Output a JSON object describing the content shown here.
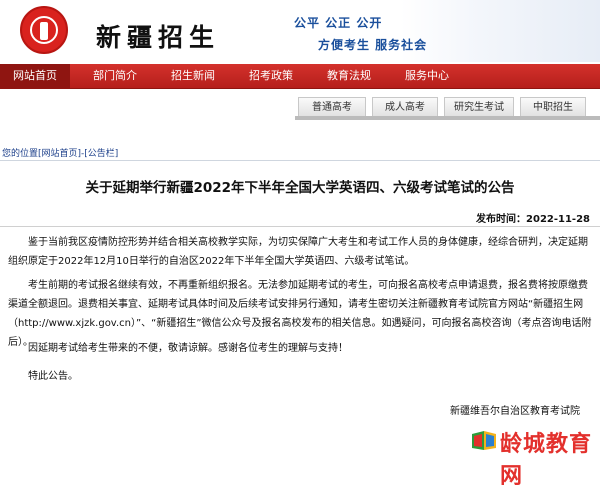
{
  "header": {
    "site_name": "新疆招生",
    "slogan_line1": "公平 公正 公开",
    "slogan_line2": "方便考生  服务社会"
  },
  "nav": {
    "items": [
      {
        "label": "网站首页",
        "active": true
      },
      {
        "label": "部门简介"
      },
      {
        "label": "招生新闻"
      },
      {
        "label": "招考政策"
      },
      {
        "label": "教育法规"
      },
      {
        "label": "服务中心"
      }
    ]
  },
  "subtabs": [
    "普通高考",
    "成人高考",
    "研究生考试",
    "中职招生"
  ],
  "breadcrumb": "您的位置[网站首页]-[公告栏]",
  "article": {
    "title": "关于延期举行新疆2022年下半年全国大学英语四、六级考试笔试的公告",
    "date_label": "发布时间：",
    "date": "2022-11-28",
    "paragraphs": [
      "鉴于当前我区疫情防控形势并结合相关高校教学实际，为切实保障广大考生和考试工作人员的身体健康，经综合研判，决定延期组织原定于2022年12月10日举行的自治区2022年下半年全国大学英语四、六级考试笔试。",
      "考生前期的考试报名继续有效，不再重新组织报名。无法参加延期考试的考生，可向报名高校考点申请退费，报名费将按原缴费渠道全额退回。退费相关事宜、延期考试具体时间及后续考试安排另行通知，请考生密切关注新疆教育考试院官方网站“新疆招生网（http://www.xjzk.gov.cn）”、“新疆招生”微信公众号及报名高校发布的相关信息。如遇疑问，可向报名高校咨询（考点咨询电话附后）。",
      "因延期考试给考生带来的不便，敬请谅解。感谢各位考生的理解与支持！",
      "特此公告。"
    ],
    "signer": "新疆维吾尔自治区教育考试院"
  },
  "watermark": {
    "text": "龄城教育网"
  },
  "colors": {
    "nav_red": "#c4261f",
    "nav_active": "#8f1511",
    "slogan_blue": "#1a4f9c"
  }
}
